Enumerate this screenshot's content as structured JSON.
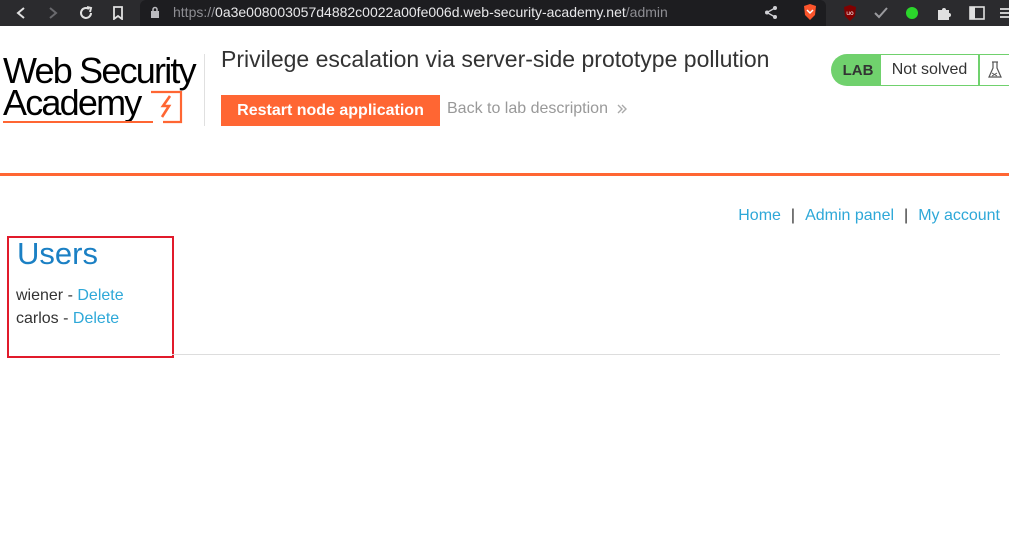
{
  "browser": {
    "url_scheme": "https://",
    "url_host": "0a3e008003057d4882c0022a00fe006d.web-security-academy.net",
    "url_path": "/admin"
  },
  "logo": {
    "line1": "Web Security",
    "line2": "Academy"
  },
  "lab": {
    "title": "Privilege escalation via server-side prototype pollution",
    "restart_label": "Restart node application",
    "back_label": "Back to lab description",
    "status_tag": "LAB",
    "status_text": "Not solved"
  },
  "nav": {
    "home": "Home",
    "admin_panel": "Admin panel",
    "my_account": "My account",
    "separator": "|"
  },
  "users": {
    "heading": "Users",
    "rows": [
      {
        "name": "wiener",
        "dash": " - ",
        "action": "Delete"
      },
      {
        "name": "carlos",
        "dash": " - ",
        "action": "Delete"
      }
    ]
  },
  "colors": {
    "accent": "#ff6633",
    "link": "#2ea8d8",
    "heading": "#1b80c4",
    "status_green": "#70d16d",
    "highlight": "#e11a2b"
  }
}
